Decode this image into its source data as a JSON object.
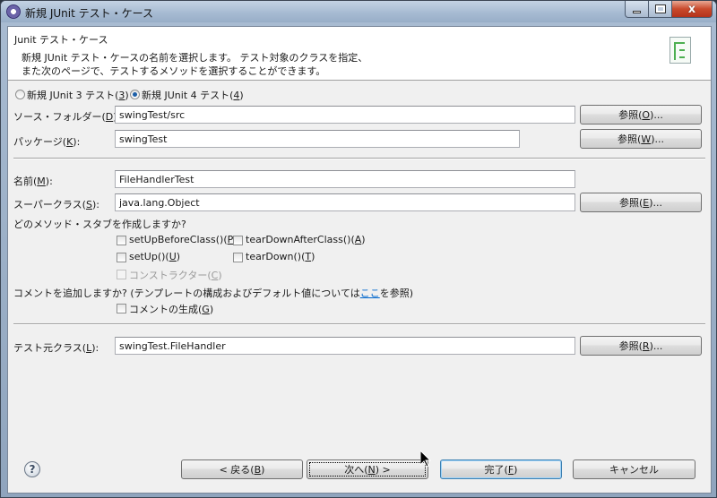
{
  "window": {
    "title": "新規 JUnit テスト・ケース",
    "minimize_glyph": "",
    "close_glyph": "x"
  },
  "banner": {
    "title": "Junit テスト・ケース",
    "description_line1": "新規 JUnit テスト・ケースの名前を選択します。 テスト対象のクラスを指定、",
    "description_line2": "また次のページで、テストするメソッドを選択することができます。"
  },
  "junit_version": {
    "junit3": {
      "label_pre": "新規 JUnit 3 テスト(",
      "mnemonic": "3",
      "label_post": ")",
      "selected": false
    },
    "junit4": {
      "label_pre": "新規 JUnit 4 テスト(",
      "mnemonic": "4",
      "label_post": ")",
      "selected": true
    }
  },
  "source_folder": {
    "label_pre": "ソース・フォルダー(",
    "mnemonic": "D",
    "label_post": "):",
    "value": "swingTest/src",
    "browse_pre": "参照(",
    "browse_mnemonic": "O",
    "browse_post": ")..."
  },
  "package": {
    "label_pre": "パッケージ(",
    "mnemonic": "K",
    "label_post": "):",
    "value": "swingTest",
    "browse_pre": "参照(",
    "browse_mnemonic": "W",
    "browse_post": ")..."
  },
  "name": {
    "label_pre": "名前(",
    "mnemonic": "M",
    "label_post": "):",
    "value": "FileHandlerTest"
  },
  "superclass": {
    "label_pre": "スーパークラス(",
    "mnemonic": "S",
    "label_post": "):",
    "value": "java.lang.Object",
    "browse_pre": "参照(",
    "browse_mnemonic": "E",
    "browse_post": ")..."
  },
  "stubs": {
    "question": "どのメソッド・スタブを作成しますか?",
    "setUpBeforeClass": {
      "pre": "setUpBeforeClass()(",
      "mn": "P",
      "post": ")",
      "checked": false
    },
    "tearDownAfterClass": {
      "pre": "tearDownAfterClass()(",
      "mn": "A",
      "post": ")",
      "checked": false
    },
    "setUp": {
      "pre": "setUp()(",
      "mn": "U",
      "post": ")",
      "checked": false
    },
    "tearDown": {
      "pre": "tearDown()(",
      "mn": "T",
      "post": ")",
      "checked": false
    },
    "constructor": {
      "pre": "コンストラクター(",
      "mn": "C",
      "post": ")",
      "checked": false,
      "enabled": false
    }
  },
  "comments": {
    "question_pre": "コメントを追加しますか? (テンプレートの構成およびデフォルト値については",
    "link": "ここ",
    "question_post": "を参照)",
    "generate": {
      "pre": "コメントの生成(",
      "mn": "G",
      "post": ")",
      "checked": false
    }
  },
  "class_under_test": {
    "label_pre": "テスト元クラス(",
    "mnemonic": "L",
    "label_post": "):",
    "value": "swingTest.FileHandler",
    "browse_pre": "参照(",
    "browse_mnemonic": "R",
    "browse_post": ")..."
  },
  "footer": {
    "help_glyph": "?",
    "back": {
      "pre": "< 戻る(",
      "mn": "B",
      "post": ")"
    },
    "next": {
      "pre": "次へ(",
      "mn": "N",
      "post": ") >"
    },
    "finish": {
      "pre": "完了(",
      "mn": "F",
      "post": ")"
    },
    "cancel": "キャンセル"
  }
}
